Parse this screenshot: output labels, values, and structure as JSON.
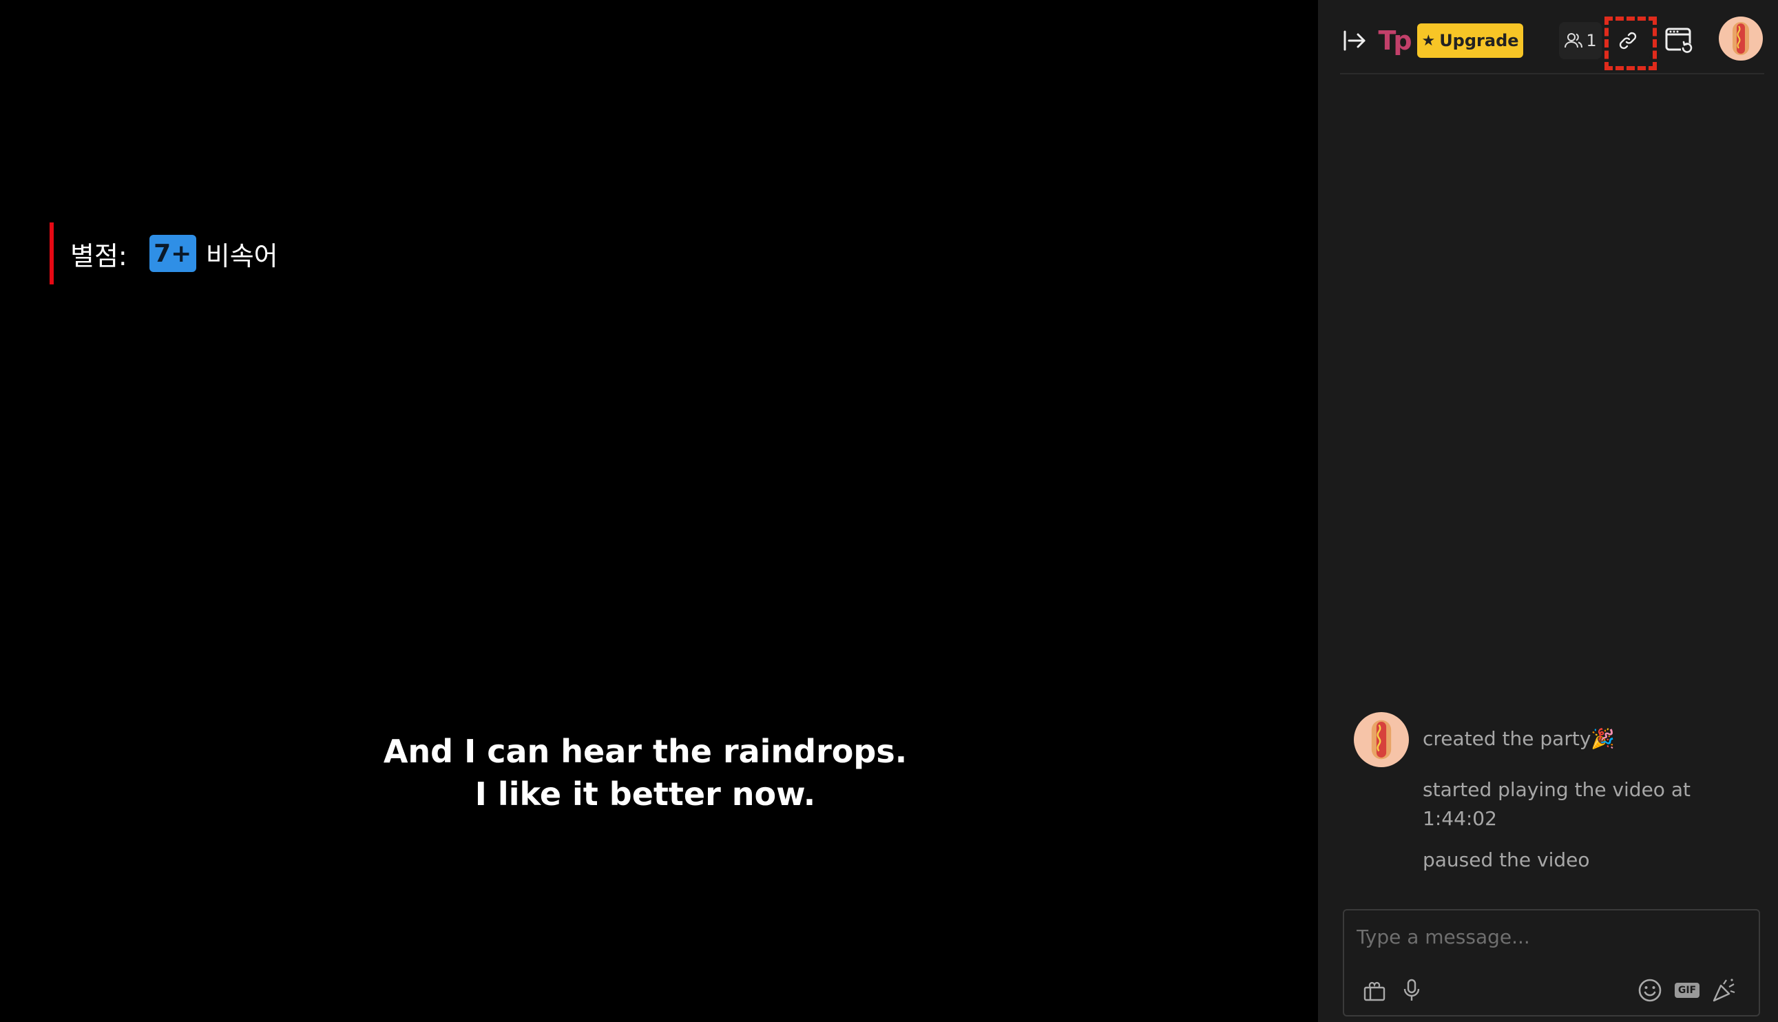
{
  "video": {
    "rating_label": "별점:",
    "rating_badge": "7+",
    "rating_desc": "비속어",
    "subtitle_line1": "And I can hear the raindrops.",
    "subtitle_line2": "I like it better now."
  },
  "sidebar": {
    "header": {
      "logo_text": "Tp",
      "upgrade_label": "Upgrade",
      "viewer_count": "1"
    },
    "feed": [
      {
        "text": "created the party🎉"
      },
      {
        "text": "started playing the video at 1:44:02"
      },
      {
        "text": "paused the video"
      }
    ],
    "composer": {
      "placeholder": "Type a message...",
      "gif_label": "GIF"
    }
  },
  "colors": {
    "sidebar_bg": "#1b1b1b",
    "upgrade_yellow": "#f7c526",
    "rating_bar": "#e50914",
    "rating_badge": "#2f8fe6",
    "highlight_red": "#e02b1c",
    "logo_pink": "#c2406a"
  },
  "icons": [
    "collapse-icon",
    "teleparty-logo",
    "star-icon",
    "users-icon",
    "link-icon",
    "window-sync-icon",
    "hotdog-avatar",
    "gift-icon",
    "microphone-icon",
    "emoji-icon",
    "gif-icon",
    "party-popper-icon"
  ]
}
